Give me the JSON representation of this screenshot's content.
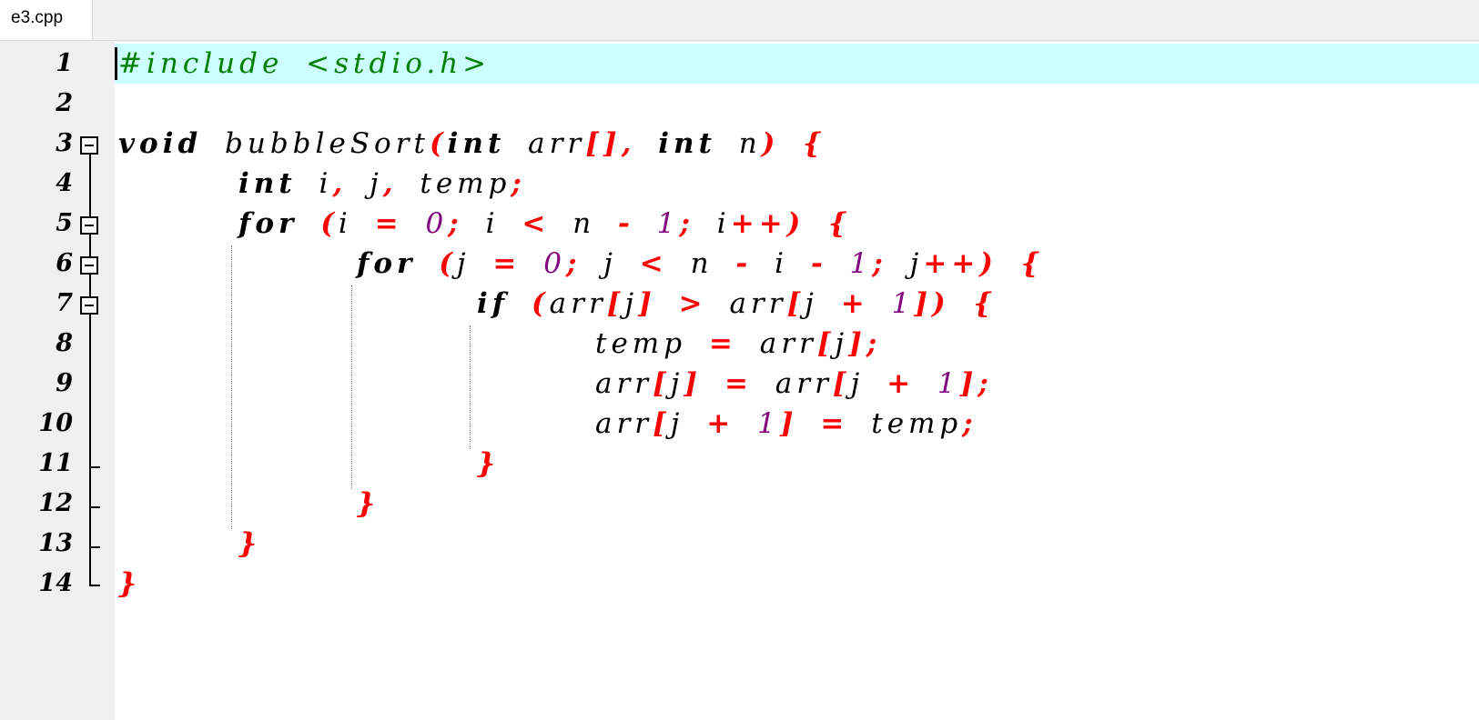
{
  "tab": {
    "title": "e3.cpp"
  },
  "line_numbers": [
    "1",
    "2",
    "3",
    "4",
    "5",
    "6",
    "7",
    "8",
    "9",
    "10",
    "11",
    "12",
    "13",
    "14"
  ],
  "code": {
    "line1": {
      "include": "#include <stdio.h>"
    },
    "line3": {
      "void": "void",
      "name": "bubbleSort",
      "lparen": "(",
      "int1": "int",
      "arr": "arr",
      "brackets": "[],",
      "int2": "int",
      "n": "n",
      "close": ") {"
    },
    "line4": {
      "int": "int",
      "i": "i",
      "comma1": ",",
      "j": "j",
      "comma2": ",",
      "temp": "temp",
      "semi": ";"
    },
    "line5": {
      "for": "for",
      "lparen": "(",
      "i1": "i",
      "eq": "=",
      "zero": "0",
      "semi1": ";",
      "i2": "i",
      "lt": "<",
      "n": "n",
      "minus": "-",
      "one": "1",
      "semi2": ";",
      "i3": "i",
      "inc": "++) {"
    },
    "line6": {
      "for": "for",
      "lparen": "(",
      "j1": "j",
      "eq": "=",
      "zero": "0",
      "semi1": ";",
      "j2": "j",
      "lt": "<",
      "n": "n",
      "minus1": "-",
      "i": "i",
      "minus2": "-",
      "one": "1",
      "semi2": ";",
      "j3": "j",
      "inc": "++) {"
    },
    "line7": {
      "if": "if",
      "lparen": "(",
      "arr1": "arr",
      "lb1": "[",
      "j1": "j",
      "rb1": "]",
      "gt": ">",
      "arr2": "arr",
      "lb2": "[",
      "j2": "j",
      "plus": "+",
      "one": "1",
      "close": "]) {"
    },
    "line8": {
      "temp": "temp",
      "eq": "=",
      "arr": "arr",
      "lb": "[",
      "j": "j",
      "rb": "];"
    },
    "line9": {
      "arr1": "arr",
      "lb1": "[",
      "j1": "j",
      "rb1": "]",
      "eq": "=",
      "arr2": "arr",
      "lb2": "[",
      "j2": "j",
      "plus": "+",
      "one": "1",
      "rb2": "];"
    },
    "line10": {
      "arr": "arr",
      "lb": "[",
      "j": "j",
      "plus": "+",
      "one": "1",
      "rb": "]",
      "eq": "=",
      "temp": "temp",
      "semi": ";"
    },
    "line11": {
      "brace": "}"
    },
    "line12": {
      "brace": "}"
    },
    "line13": {
      "brace": "}"
    },
    "line14": {
      "brace": "}"
    }
  },
  "colors": {
    "keyword": "#000000",
    "operator": "#ff0000",
    "number": "#800080",
    "preprocessor": "#008000",
    "current_line": "#ccffff"
  }
}
